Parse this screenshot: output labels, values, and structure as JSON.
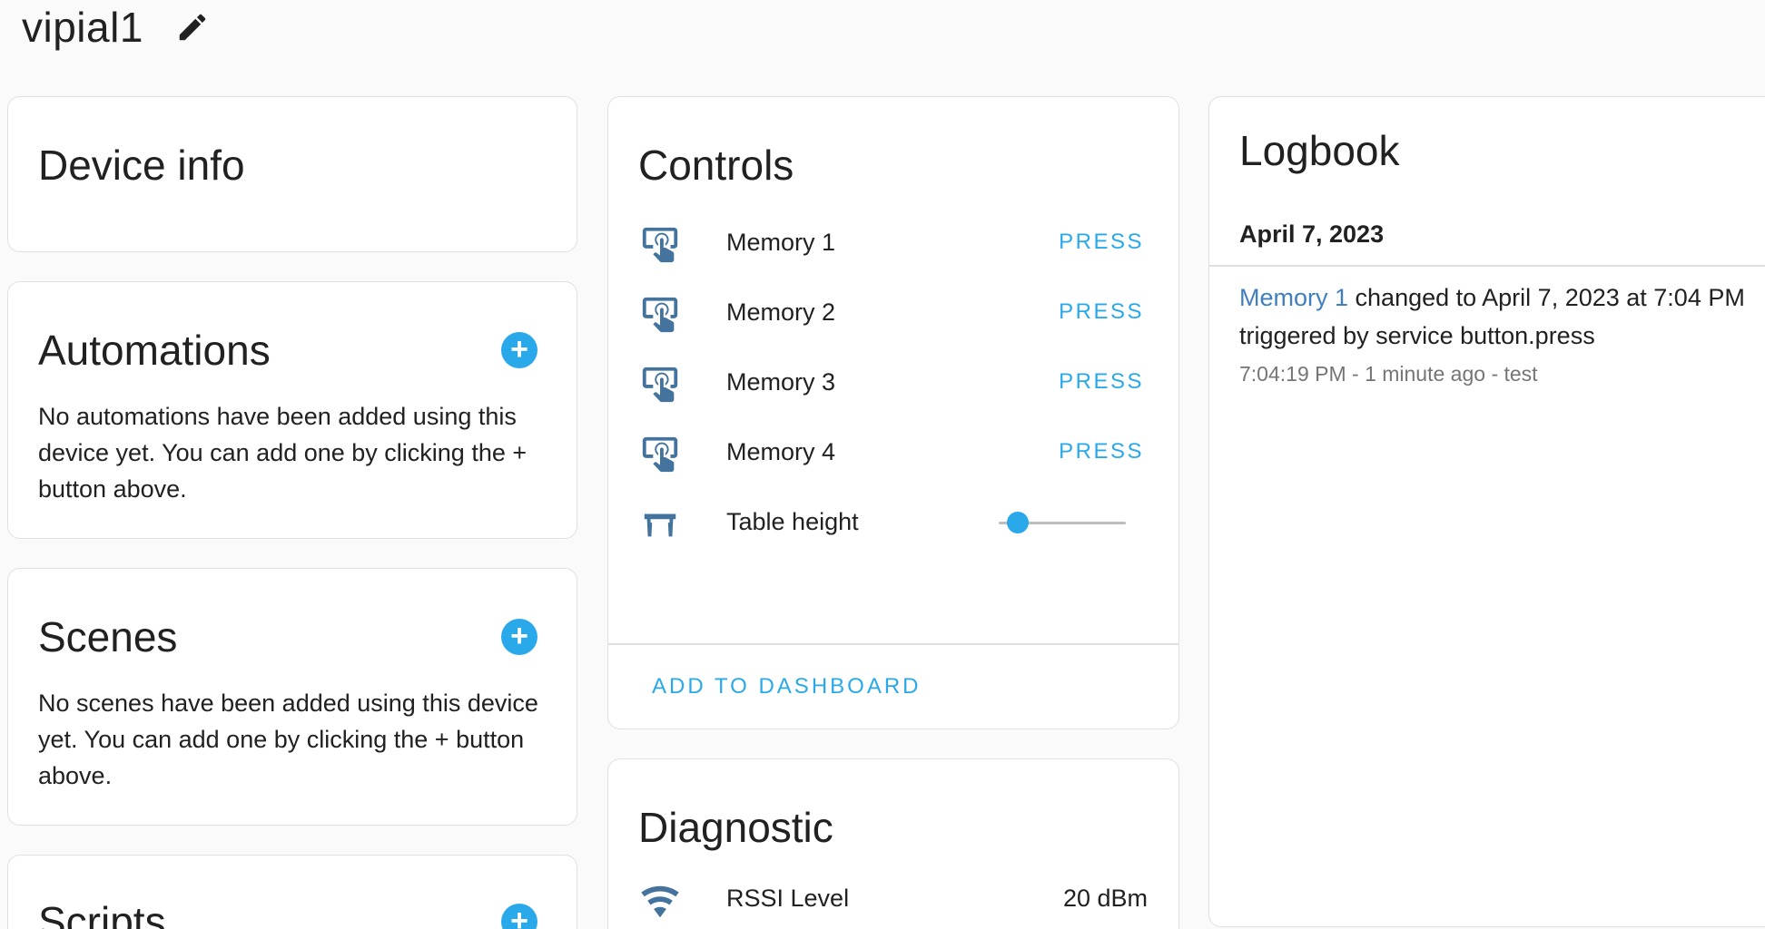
{
  "header": {
    "title": "vipial1",
    "edit_icon": "pencil-icon"
  },
  "device_info": {
    "title": "Device info"
  },
  "automations": {
    "title": "Automations",
    "text": "No automations have been added using this device yet. You can add one by clicking the + button above.",
    "add_icon": "plus-circle-icon"
  },
  "scenes": {
    "title": "Scenes",
    "text": "No scenes have been added using this device yet. You can add one by clicking the + button above.",
    "add_icon": "plus-circle-icon"
  },
  "scripts": {
    "title": "Scripts",
    "add_icon": "plus-circle-icon"
  },
  "controls": {
    "title": "Controls",
    "items": [
      {
        "label": "Memory 1",
        "action": "PRESS",
        "icon": "gesture-tap-button-icon"
      },
      {
        "label": "Memory 2",
        "action": "PRESS",
        "icon": "gesture-tap-button-icon"
      },
      {
        "label": "Memory 3",
        "action": "PRESS",
        "icon": "gesture-tap-button-icon"
      },
      {
        "label": "Memory 4",
        "action": "PRESS",
        "icon": "gesture-tap-button-icon"
      }
    ],
    "table_height": {
      "label": "Table height",
      "icon": "table-icon",
      "slider_value_fraction": 0.08
    },
    "add_to_dashboard": "ADD TO DASHBOARD"
  },
  "diagnostic": {
    "title": "Diagnostic",
    "items": [
      {
        "label": "RSSI Level",
        "value": "20 dBm",
        "icon": "wifi-icon"
      }
    ]
  },
  "logbook": {
    "title": "Logbook",
    "date": "April 7, 2023",
    "entry_entity": "Memory 1",
    "entry_text": " changed to April 7, 2023 at 7:04 PM triggered by service button.press",
    "entry_meta": "7:04:19 PM - 1 minute ago - test"
  },
  "colors": {
    "accent": "#29a9ea",
    "icon": "#44739e",
    "link": "#3f7fbf"
  }
}
